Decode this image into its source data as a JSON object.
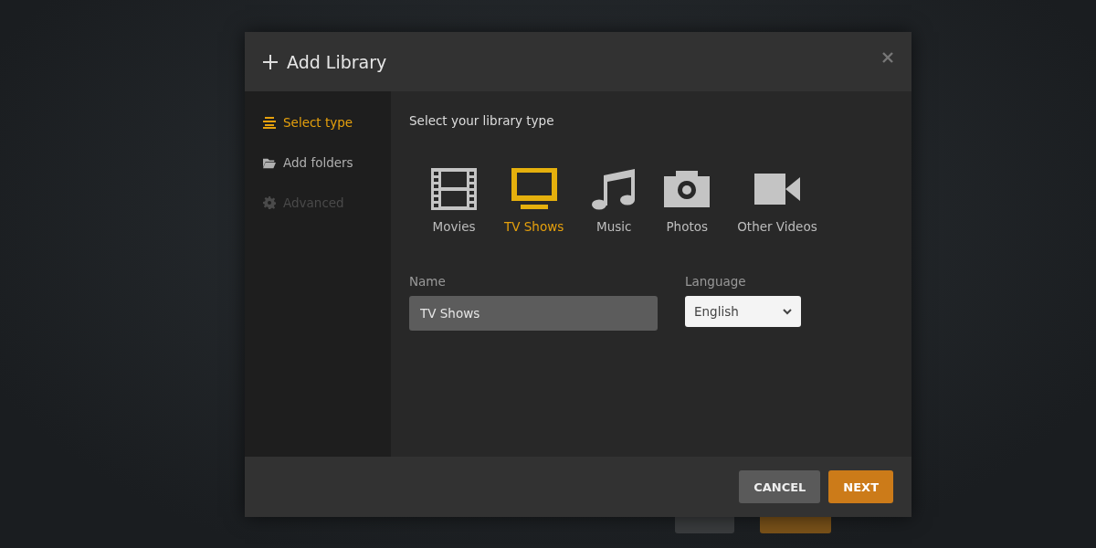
{
  "dialog": {
    "title": "Add Library",
    "steps": [
      {
        "label": "Select type",
        "kind": "list",
        "selected": true,
        "disabled": false
      },
      {
        "label": "Add folders",
        "kind": "folder",
        "selected": false,
        "disabled": false
      },
      {
        "label": "Advanced",
        "kind": "gear",
        "selected": false,
        "disabled": true
      }
    ],
    "prompt": "Select your library type",
    "types": [
      {
        "label": "Movies",
        "kind": "film",
        "selected": false
      },
      {
        "label": "TV Shows",
        "kind": "tv",
        "selected": true
      },
      {
        "label": "Music",
        "kind": "music",
        "selected": false
      },
      {
        "label": "Photos",
        "kind": "camera",
        "selected": false
      },
      {
        "label": "Other Videos",
        "kind": "video",
        "selected": false
      }
    ],
    "name_field": {
      "label": "Name",
      "value": "TV Shows"
    },
    "language_field": {
      "label": "Language",
      "value": "English"
    },
    "buttons": [
      {
        "label": "CANCEL",
        "kind": "secondary"
      },
      {
        "label": "NEXT",
        "kind": "primary"
      }
    ]
  }
}
